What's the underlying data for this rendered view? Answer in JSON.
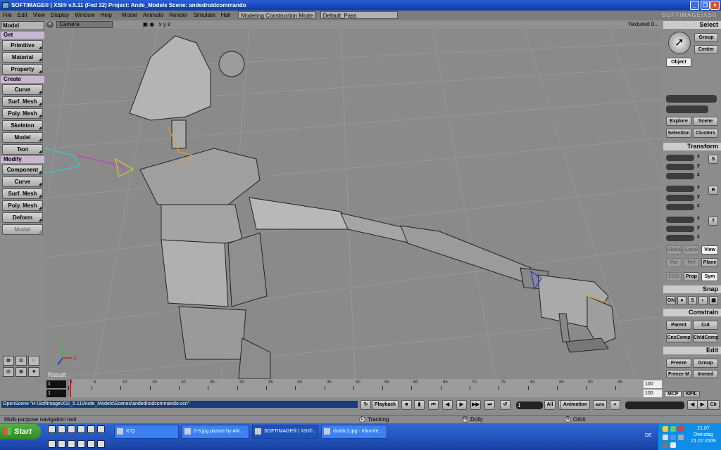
{
  "window": {
    "title": "SOFTIMAGE® | XSI® v.5.11 (Fnd 32) Project: Ande_Models    Scene: andedroidcommando",
    "brand": "SOFTIMAGE|XSI|"
  },
  "menu": {
    "items": [
      "File",
      "Edit",
      "View",
      "Display",
      "Window",
      "Help",
      "Model",
      "Animate",
      "Render",
      "Simulate",
      "Hair"
    ],
    "layout_combo": "Modeling Construction Mode",
    "pass_combo": "Default_Pass"
  },
  "left_panel": {
    "mode": "Model",
    "sections": [
      {
        "title": "Get",
        "buttons": [
          "Primitive",
          "Material",
          "Property"
        ]
      },
      {
        "title": "Create",
        "buttons": [
          "Curve",
          "Surf. Mesh",
          "Poly. Mesh",
          "Skeleton",
          "Model",
          "Text"
        ]
      },
      {
        "title": "Modify",
        "buttons": [
          "Component",
          "Curve",
          "Surf. Mesh",
          "Poly. Mesh",
          "Deform",
          "Model"
        ]
      }
    ]
  },
  "viewport": {
    "badge": "B",
    "camera": "Camera",
    "axes": "x  y  z",
    "display_mode": "Textured 0...",
    "label": "Result"
  },
  "right_panel": {
    "select": {
      "title": "Select",
      "group": "Group",
      "center": "Center",
      "object": "Object",
      "explore": "Explore",
      "scene": "Scene",
      "selection": "Selection",
      "clusters": "Clusters"
    },
    "transform": {
      "title": "Transform",
      "axis_labels": [
        "x",
        "y",
        "z"
      ],
      "s": "S",
      "r": "R",
      "t": "T",
      "global": "Global",
      "local": "Local",
      "view": "View",
      "par": "Par",
      "ref": "Ref",
      "plane": "Plane",
      "cog": "COG",
      "prop": "Prop",
      "sym": "Sym"
    },
    "snap": {
      "title": "Snap",
      "on": "ON"
    },
    "constrain": {
      "title": "Constrain",
      "parent": "Parent",
      "cut": "Cut",
      "cnscomp": "CnsComp",
      "childcomp": "ChldComp"
    },
    "edit": {
      "title": "Edit",
      "freeze": "Freeze",
      "group": "Group",
      "freeze_m": "Freeze M",
      "immed": "Immed"
    },
    "mcp": "MCP",
    "kpl": "KP/L"
  },
  "timeline": {
    "start": "1",
    "start2": "1",
    "end": "100",
    "end2": "100",
    "ticks": [
      1,
      5,
      10,
      15,
      20,
      25,
      30,
      35,
      40,
      45,
      50,
      55,
      60,
      65,
      70,
      75,
      80,
      85,
      90,
      95
    ]
  },
  "command": {
    "text": "OpenScene \"H:\\Softimage\\XSI_5.11\\Ande_Models\\Scenes\\andedroidcommando.scn\"",
    "playback": "Playback",
    "frame_field": "1",
    "all": "All",
    "animation": "Animation",
    "auto": "auto",
    "clr": "Clr"
  },
  "status": {
    "message": "Multi-purpose navigation tool",
    "l_key": "L",
    "l_label": "Tracking",
    "m_key": "M",
    "m_label": "Dolly",
    "r_key": "R",
    "r_label": "Orbit"
  },
  "taskbar": {
    "start": "Start",
    "tasks": [
      "ICQ",
      "2-3.jpg picture by AN...",
      "SOFTIMAGE® | XSI®...",
      "droidc1.jpg - IrfanVie..."
    ],
    "lang": "DE",
    "time": "21:07",
    "day": "Dienstag",
    "date": "21.07.2009"
  }
}
